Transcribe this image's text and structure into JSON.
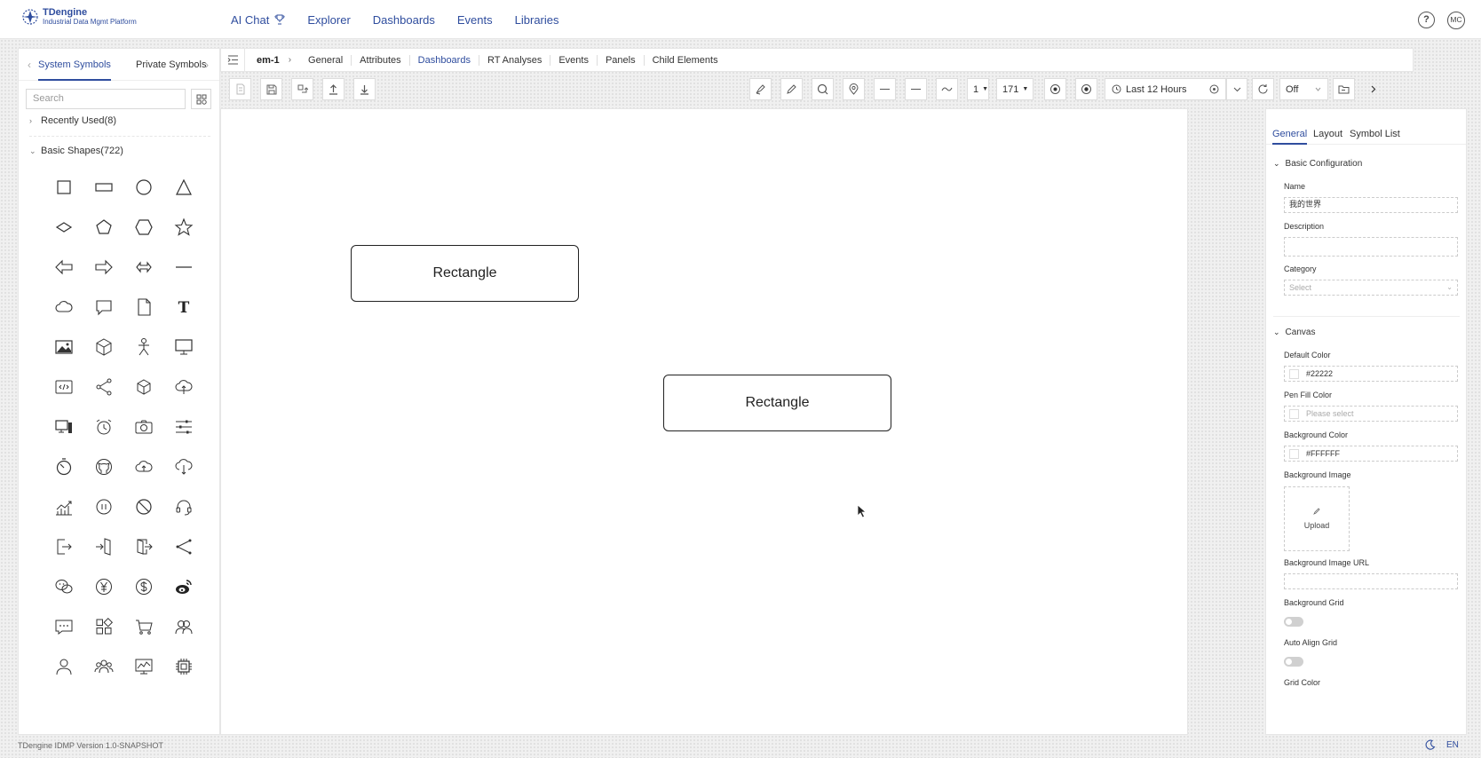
{
  "app": {
    "logo_title": "TDengine",
    "logo_subtitle": "Industrial Data Mgmt Platform"
  },
  "topnav": [
    {
      "label": "AI Chat"
    },
    {
      "label": "Explorer"
    },
    {
      "label": "Dashboards"
    },
    {
      "label": "Events"
    },
    {
      "label": "Libraries"
    }
  ],
  "user": {
    "help": "?",
    "avatar_initials": "MC"
  },
  "symbols": {
    "tab_system": "System Symbols",
    "tab_private": "Private Symbols",
    "search_placeholder": "Search",
    "recently_used": "Recently Used(8)",
    "basic_shapes": "Basic Shapes(722)",
    "shapes": [
      "square-shape",
      "rectangle-shape",
      "circle-shape",
      "triangle-shape",
      "diamond-shape",
      "pentagon-shape",
      "hexagon-shape",
      "star-shape",
      "arrow-left-shape",
      "arrow-right-shape",
      "double-arrow-shape",
      "line-shape",
      "cloud-shape",
      "speech-bubble-shape",
      "document-shape",
      "text-shape",
      "image-icon",
      "cube-icon",
      "actor-icon",
      "monitor-icon",
      "code-window-icon",
      "share-icon",
      "box-icon",
      "cloud-upload-icon",
      "computer-icon",
      "alarm-clock-icon",
      "camera-icon",
      "sliders-icon",
      "timer-icon",
      "github-icon",
      "cloud-up-icon",
      "cloud-down-icon",
      "stock-chart-icon",
      "pause-icon",
      "ban-icon",
      "headset-icon",
      "logout-icon",
      "door-in-icon",
      "door-out-icon",
      "share-alt-icon",
      "wechat-icon",
      "yen-icon",
      "dollar-icon",
      "weibo-icon",
      "message-icon",
      "apps-icon",
      "cart-icon",
      "users-icon",
      "user-icon",
      "team-icon",
      "chart-monitor-icon",
      "chip-icon"
    ]
  },
  "breadcrumb": {
    "root": "em-1",
    "items": [
      {
        "label": "General",
        "active": false
      },
      {
        "label": "Attributes",
        "active": false
      },
      {
        "label": "Dashboards",
        "active": true
      },
      {
        "label": "RT Analyses",
        "active": false
      },
      {
        "label": "Events",
        "active": false
      },
      {
        "label": "Panels",
        "active": false
      },
      {
        "label": "Child Elements",
        "active": false
      }
    ]
  },
  "toolbar": {
    "line_width": "1",
    "zoom": "171",
    "time_range": "Last 12 Hours",
    "refresh": "Off"
  },
  "canvas": {
    "shapes": [
      {
        "label": "Rectangle"
      },
      {
        "label": "Rectangle"
      }
    ]
  },
  "properties": {
    "tabs": [
      {
        "label": "General",
        "active": true
      },
      {
        "label": "Layout",
        "active": false
      },
      {
        "label": "Symbol List",
        "active": false
      }
    ],
    "basic_config": {
      "title": "Basic Configuration",
      "name_label": "Name",
      "name_value": "我的世界",
      "description_label": "Description",
      "description_value": "",
      "category_label": "Category",
      "category_placeholder": "Select"
    },
    "canvas": {
      "title": "Canvas",
      "default_color_label": "Default Color",
      "default_color_value": "#22222",
      "pen_fill_label": "Pen Fill Color",
      "pen_fill_placeholder": "Please select",
      "bg_color_label": "Background Color",
      "bg_color_value": "#FFFFFF",
      "bg_image_label": "Background Image",
      "upload_label": "Upload",
      "bg_image_url_label": "Background Image URL",
      "bg_grid_label": "Background Grid",
      "auto_align_label": "Auto Align Grid",
      "grid_color_label": "Grid Color"
    }
  },
  "footer": {
    "version": "TDengine IDMP Version 1.0-SNAPSHOT",
    "lang": "EN"
  },
  "colors": {
    "accent": "#2f4d9e",
    "border": "#e6e6e6"
  }
}
